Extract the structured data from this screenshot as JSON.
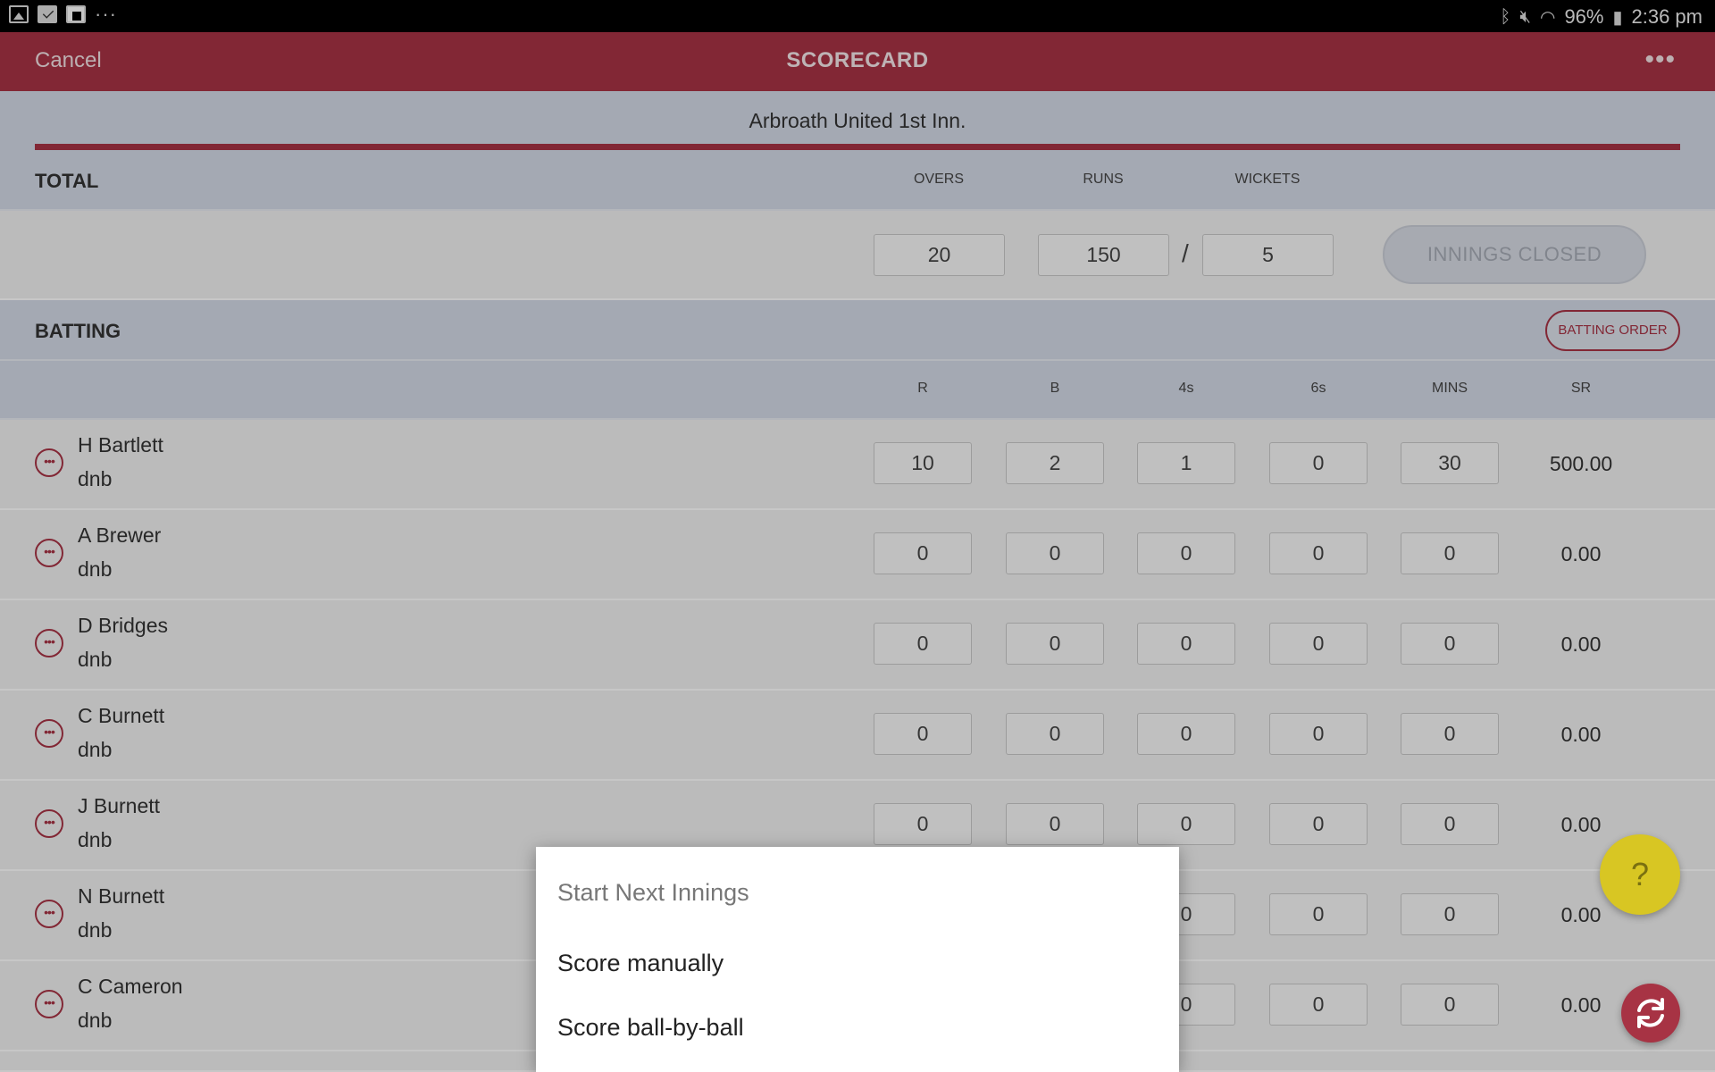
{
  "status_bar": {
    "battery": "96%",
    "time": "2:36 pm",
    "left_icons": [
      "gallery-icon",
      "mail-icon",
      "flipboard-icon",
      "more-notifications-icon"
    ],
    "right_icons": [
      "bluetooth-icon",
      "mute-icon",
      "wifi-icon",
      "battery-icon"
    ]
  },
  "app_bar": {
    "cancel": "Cancel",
    "title": "SCORECARD",
    "more_icon": "more-horizontal-icon"
  },
  "innings_tab": "Arbroath United 1st Inn.",
  "total": {
    "heading": "TOTAL",
    "overs_label": "OVERS",
    "runs_label": "RUNS",
    "wickets_label": "WICKETS",
    "overs": "20",
    "runs": "150",
    "slash": "/",
    "wickets": "5",
    "innings_closed": "INNINGS CLOSED"
  },
  "batting": {
    "heading": "BATTING",
    "order_button": "BATTING ORDER",
    "columns": [
      "R",
      "B",
      "4s",
      "6s",
      "MINS",
      "SR"
    ],
    "players": [
      {
        "name": "H Bartlett",
        "status": "dnb",
        "r": "10",
        "b": "2",
        "fours": "1",
        "sixes": "0",
        "mins": "30",
        "sr": "500.00"
      },
      {
        "name": "A Brewer",
        "status": "dnb",
        "r": "0",
        "b": "0",
        "fours": "0",
        "sixes": "0",
        "mins": "0",
        "sr": "0.00"
      },
      {
        "name": "D Bridges",
        "status": "dnb",
        "r": "0",
        "b": "0",
        "fours": "0",
        "sixes": "0",
        "mins": "0",
        "sr": "0.00"
      },
      {
        "name": "C Burnett",
        "status": "dnb",
        "r": "0",
        "b": "0",
        "fours": "0",
        "sixes": "0",
        "mins": "0",
        "sr": "0.00"
      },
      {
        "name": "J Burnett",
        "status": "dnb",
        "r": "0",
        "b": "0",
        "fours": "0",
        "sixes": "0",
        "mins": "0",
        "sr": "0.00"
      },
      {
        "name": "N Burnett",
        "status": "dnb",
        "r": "",
        "b": "",
        "fours": "0",
        "sixes": "0",
        "mins": "0",
        "sr": "0.00"
      },
      {
        "name": "C Cameron",
        "status": "dnb",
        "r": "",
        "b": "",
        "fours": "0",
        "sixes": "0",
        "mins": "0",
        "sr": "0.00"
      }
    ]
  },
  "dialog": {
    "title": "Start Next Innings",
    "option_manual": "Score manually",
    "option_ball": "Score ball-by-ball"
  },
  "fab": {
    "help": "?",
    "help_icon": "help-icon",
    "sync_icon": "sync-icon"
  },
  "colors": {
    "brand": "#a73344",
    "header_bg": "#d3d9e6",
    "row_bg": "#f0f0f0",
    "help_fab": "#d8c623"
  }
}
